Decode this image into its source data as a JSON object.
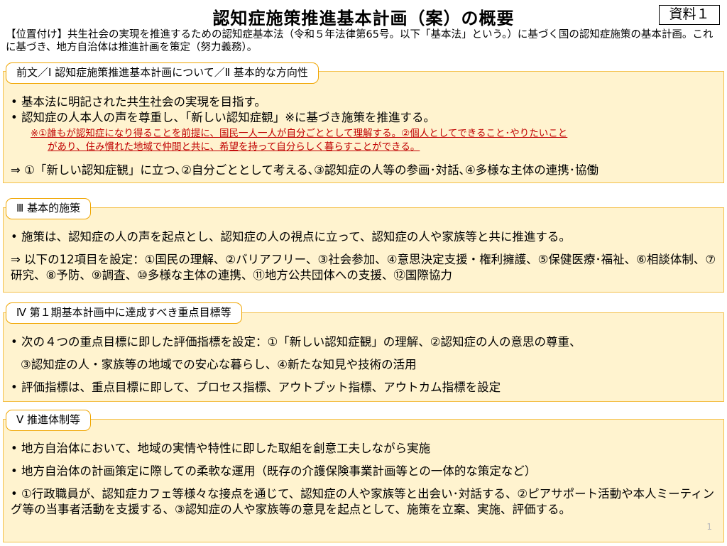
{
  "header": {
    "title": "認知症施策推進基本計画（案）の概要",
    "badge": "資料１",
    "position_note": "【位置付け】共生社会の実現を推進するための認知症基本法（令和５年法律第65号。以下「基本法」という。）に基づく国の認知症施策の基本計画。これに基づき、地方自治体は推進計画を策定（努力義務）。"
  },
  "section1": {
    "tab": "前文／Ⅰ 認知症施策推進基本計画について／Ⅱ 基本的な方向性",
    "bullet1": "• 基本法に明記された共生社会の実現を目指す。",
    "bullet2": "• 認知症の人本人の声を尊重し、「新しい認知症観」※に基づき施策を推進する。",
    "note_line1": "※①誰もが認知症になり得ることを前提に、国民一人一人が自分ごととして理解する。②個人としてできること･やりたいこと",
    "note_line2": "があり、住み慣れた地域で仲間と共に、希望を持って自分らしく暮らすことができる。",
    "arrow": "⇒ ①「新しい認知症観」に立つ､②自分ごととして考える､③認知症の人等の参画･対話､④多様な主体の連携･協働"
  },
  "section2": {
    "tab": "Ⅲ 基本的施策",
    "bullet1": "• 施策は、認知症の人の声を起点とし、認知症の人の視点に立って、認知症の人や家族等と共に推進する。",
    "arrow": "⇒ 以下の12項目を設定：①国民の理解、②バリアフリー、③社会参加、④意思決定支援・権利擁護、⑤保健医療･福祉、⑥相談体制、⑦研究、⑧予防、⑨調査、⑩多様な主体の連携、⑪地方公共団体への支援、⑫国際協力"
  },
  "section3": {
    "tab": "Ⅳ 第１期基本計画中に達成すべき重点目標等",
    "bullet1_line1": "• 次の４つの重点目標に即した評価指標を設定：①「新しい認知症観」の理解、②認知症の人の意思の尊重、",
    "bullet1_line2": "③認知症の人・家族等の地域での安心な暮らし、④新たな知見や技術の活用",
    "bullet2": "• 評価指標は、重点目標に即して、プロセス指標、アウトプット指標、アウトカム指標を設定"
  },
  "section4": {
    "tab": "Ⅴ 推進体制等",
    "bullet1": "• 地方自治体において、地域の実情や特性に即した取組を創意工夫しながら実施",
    "bullet2": "• 地方自治体の計画策定に際しての柔軟な運用（既存の介護保険事業計画等との一体的な策定など）",
    "bullet3": "• ①行政職員が、認知症カフェ等様々な接点を通じて、認知症の人や家族等と出会い･対話する、②ピアサポート活動や本人ミーティング等の当事者活動を支援する、③認知症の人や家族等の意見を起点として、施策を立案、実施、評価する。"
  },
  "page_number": "1"
}
